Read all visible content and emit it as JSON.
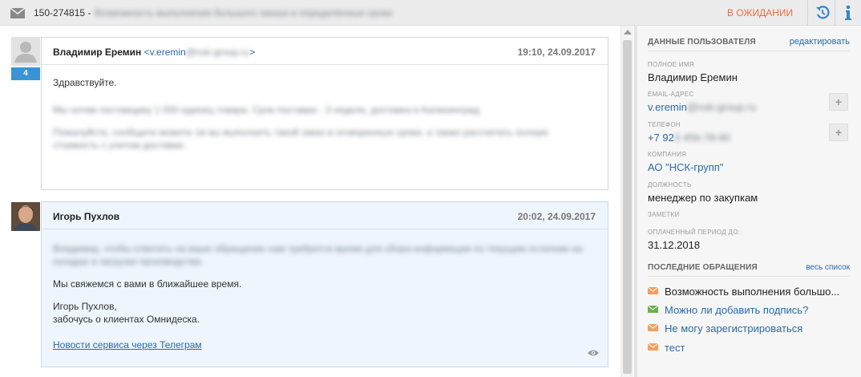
{
  "topbar": {
    "icon": "envelope-icon",
    "ticket_id": "150-274815 -",
    "subject": "Возможность выполнения большого заказа в определённые сроки",
    "status": "В ОЖИДАНИИ",
    "status_color": "#f26b3a",
    "actions": [
      "history-icon",
      "info-icon"
    ]
  },
  "messages": [
    {
      "author": "Владимир Еремин",
      "email_prefix": "<v.eremin",
      "email_hidden": "@nsk-group.ru",
      "email_suffix": ">",
      "time": "19:10, 24.09.2017",
      "badge": "4",
      "lines": [
        "Здравствуйте.",
        "Мы хотим поставщику 1 000 единиц товара. Срок поставки - 3 недели, доставка в Калининград.",
        "Пожалуйста, сообщите можете ли вы выполнить такой заказ в оговоренные сроки, а также рассчитать полную стоимость с учетом доставки."
      ]
    },
    {
      "author": "Игорь Пухлов",
      "time": "20:02, 24.09.2017",
      "lines": [
        "Владимир, чтобы ответить на ваше обращение нам требуется время для сбора информации по текущим остаткам на складах и загрузке производства.",
        "Мы свяжемся с вами в ближайшее время.",
        "Игорь Пухлов,",
        "забочусь о клиентах Омнидеска."
      ],
      "link": "Новости сервиса через Телеграм"
    }
  ],
  "panel": {
    "title": "ДАННЫЕ ПОЛЬЗОВАТЕЛЯ",
    "edit": "редактировать",
    "fields": {
      "full_name_label": "ПОЛНОЕ ИМЯ",
      "full_name": "Владимир Еремин",
      "email_label": "EMAIL-АДРЕС",
      "email": "v.eremin",
      "email_hidden": "@nsk-group.ru",
      "phone_label": "ТЕЛЕФОН",
      "phone": "+7 92",
      "phone_hidden": "3 456-78-90",
      "company_label": "КОМПАНИЯ",
      "company": "АО \"НСК-групп\"",
      "position_label": "ДОЛЖНОСТЬ",
      "position": "менеджер по закупкам",
      "notes_label": "ЗАМЕТКИ",
      "paid_label": "ОПЛАЧЕННЫЙ ПЕРИОД ДО:",
      "paid": "31.12.2018"
    },
    "recent_title": "ПОСЛЕДНИЕ ОБРАЩЕНИЯ",
    "recent_all": "весь список",
    "recent": [
      {
        "label": "Возможность выполнения большо...",
        "color": "#f0a060"
      },
      {
        "label": "Можно ли добавить подпись?",
        "color": "#6ab04c"
      },
      {
        "label": "Не могу зарегистрироваться",
        "color": "#f0a060"
      },
      {
        "label": "тест",
        "color": "#f0a060"
      }
    ]
  }
}
